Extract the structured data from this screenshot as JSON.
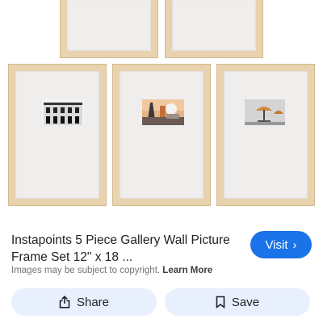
{
  "product": {
    "title": "Instapoints 5 Piece Gallery Wall Picture Frame Set 12\" x 18 ...",
    "visit_label": "Visit",
    "visit_icon": "chevron-right-icon"
  },
  "notice": {
    "text": "Images may be subject to copyright.",
    "learn_more": "Learn More"
  },
  "actions": {
    "share_label": "Share",
    "share_icon": "share-icon",
    "save_label": "Save",
    "save_icon": "bookmark-icon"
  },
  "colors": {
    "accent": "#1a73e8",
    "action_bg": "#e8f0fe",
    "frame_wood": "#e9d2ae"
  }
}
